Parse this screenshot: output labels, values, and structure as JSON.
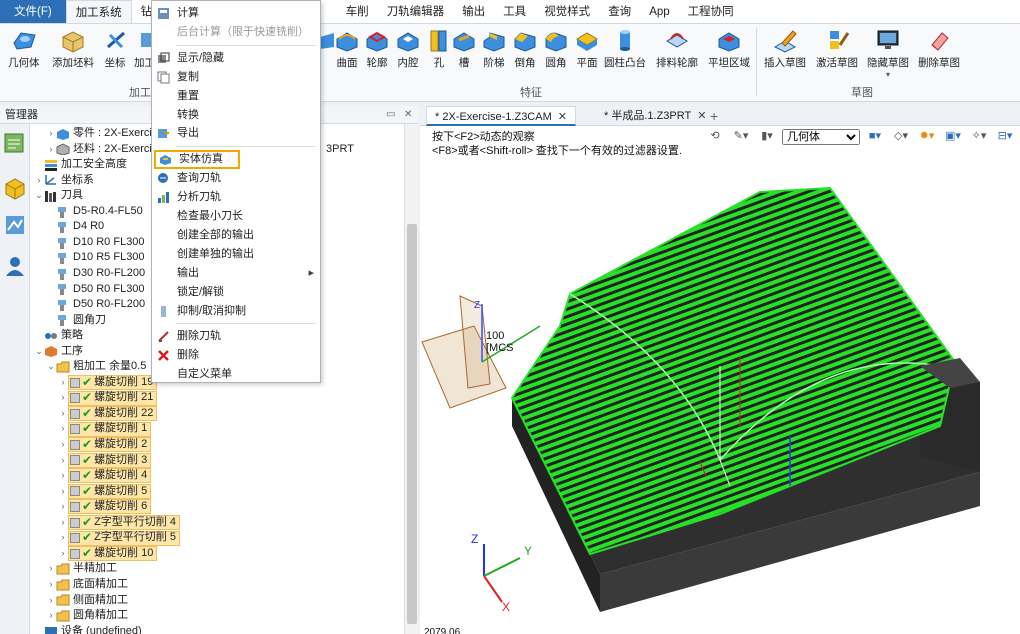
{
  "menubar": {
    "items": [
      "文件(F)",
      "加工系统",
      "钻孔",
      "刀",
      "车削",
      "刀轨编辑器",
      "输出",
      "工具",
      "视觉样式",
      "查询",
      "App",
      "工程协同"
    ]
  },
  "ribbon": {
    "buttons": [
      "几何体",
      "添加坯料",
      "坐标",
      "加工",
      "曲面",
      "轮廓",
      "内腔",
      "孔",
      "槽",
      "阶梯",
      "倒角",
      "圆角",
      "平面",
      "圆柱凸台",
      "排料轮廓",
      "平坦区域",
      "插入草图",
      "激活草图",
      "隐藏草图",
      "删除草图"
    ],
    "groups": [
      "加工",
      "特征",
      "草图"
    ]
  },
  "manager": {
    "title": "管理器"
  },
  "tree": [
    {
      "label": "零件 : 2X-Exercise-",
      "level": 1,
      "exp": ">",
      "icon": "part-icon"
    },
    {
      "label": "坯料 : 2X-Exercise",
      "level": 1,
      "exp": ">",
      "icon": "stock-icon",
      "suffix": "3PRT"
    },
    {
      "label": "加工安全高度",
      "level": 0,
      "exp": "",
      "icon": "safety-height-icon"
    },
    {
      "label": "坐标系",
      "level": 0,
      "exp": ">",
      "icon": "coordinate-icon"
    },
    {
      "label": "刀具",
      "level": 0,
      "exp": "v",
      "icon": "tools-icon"
    },
    {
      "label": "D5-R0.4-FL50",
      "level": 1,
      "exp": "",
      "icon": "tool-icon"
    },
    {
      "label": "D4 R0",
      "level": 1,
      "exp": "",
      "icon": "tool-icon"
    },
    {
      "label": "D10 R0 FL300",
      "level": 1,
      "exp": "",
      "icon": "tool-icon"
    },
    {
      "label": "D10 R5 FL300",
      "level": 1,
      "exp": "",
      "icon": "tool-icon"
    },
    {
      "label": "D30 R0-FL200",
      "level": 1,
      "exp": "",
      "icon": "tool-icon"
    },
    {
      "label": "D50 R0 FL300",
      "level": 1,
      "exp": "",
      "icon": "tool-icon"
    },
    {
      "label": "D50 R0-FL200",
      "level": 1,
      "exp": "",
      "icon": "tool-icon"
    },
    {
      "label": "圆角刀",
      "level": 1,
      "exp": "",
      "icon": "tool-icon"
    },
    {
      "label": "策略",
      "level": 0,
      "exp": "",
      "icon": "strategy-icon"
    },
    {
      "label": "工序",
      "level": 0,
      "exp": "v",
      "icon": "operations-icon"
    },
    {
      "label": "粗加工 余量0.5",
      "level": 1,
      "exp": "v",
      "icon": "folder-icon"
    },
    {
      "label": "螺旋切削 19",
      "level": 2,
      "exp": ">",
      "icon": "op",
      "hl": true
    },
    {
      "label": "螺旋切削 21",
      "level": 2,
      "exp": ">",
      "icon": "op",
      "hl": true
    },
    {
      "label": "螺旋切削 22",
      "level": 2,
      "exp": ">",
      "icon": "op",
      "hl": true
    },
    {
      "label": "螺旋切削 1",
      "level": 2,
      "exp": ">",
      "icon": "op",
      "hl": true
    },
    {
      "label": "螺旋切削 2",
      "level": 2,
      "exp": ">",
      "icon": "op",
      "hl": true
    },
    {
      "label": "螺旋切削 3",
      "level": 2,
      "exp": ">",
      "icon": "op",
      "hl": true
    },
    {
      "label": "螺旋切削 4",
      "level": 2,
      "exp": ">",
      "icon": "op",
      "hl": true
    },
    {
      "label": "螺旋切削 5",
      "level": 2,
      "exp": ">",
      "icon": "op",
      "hl": true
    },
    {
      "label": "螺旋切削 6",
      "level": 2,
      "exp": ">",
      "icon": "op",
      "hl": true
    },
    {
      "label": "Z字型平行切削 4",
      "level": 2,
      "exp": ">",
      "icon": "op",
      "hl": true
    },
    {
      "label": "Z字型平行切削 5",
      "level": 2,
      "exp": ">",
      "icon": "op",
      "hl": true
    },
    {
      "label": "螺旋切削 10",
      "level": 2,
      "exp": ">",
      "icon": "op",
      "hl": true
    },
    {
      "label": "半精加工",
      "level": 1,
      "exp": ">",
      "icon": "folder-icon"
    },
    {
      "label": "底面精加工",
      "level": 1,
      "exp": ">",
      "icon": "folder-icon"
    },
    {
      "label": "侧面精加工",
      "level": 1,
      "exp": ">",
      "icon": "folder-icon"
    },
    {
      "label": "圆角精加工",
      "level": 1,
      "exp": ">",
      "icon": "folder-icon"
    },
    {
      "label": "设备 (undefined)",
      "level": 0,
      "exp": "",
      "icon": "device-icon"
    }
  ],
  "tabs": [
    {
      "label": "* 2X-Exercise-1.Z3CAM",
      "close": "✕"
    },
    {
      "label": "* 半成品.1.Z3PRT",
      "close": "✕"
    },
    {
      "label": "+"
    }
  ],
  "viewport": {
    "hint_line1": "按下<F2>动态的观察",
    "hint_line2": "<F8>或者<Shift-roll> 查找下一个有效的过滤器设置.",
    "filter_value": "几何体",
    "csys_label": "100",
    "csys_sub": "[MCS",
    "axis_z": "Z",
    "axis_y": "Y",
    "axis_x": "X",
    "bottom_text": "2079.06"
  },
  "context_menu": {
    "items": [
      {
        "label": "计算",
        "icon": "calc-icon"
      },
      {
        "label": "后台计算（限于快速铣削）",
        "disabled": true
      },
      {
        "sep": true
      },
      {
        "label": "显示/隐藏",
        "icon": "show-hide-icon"
      },
      {
        "label": "复制",
        "icon": "copy-icon"
      },
      {
        "label": "重置"
      },
      {
        "label": "转换"
      },
      {
        "label": "导出",
        "icon": "export-icon"
      },
      {
        "sep": true
      },
      {
        "label": "实体仿真",
        "icon": "simulate-icon",
        "hl": true
      },
      {
        "label": "查询刀轨",
        "icon": "query-icon"
      },
      {
        "label": "分析刀轨",
        "icon": "analyze-icon"
      },
      {
        "label": "检查最小刀长"
      },
      {
        "label": "创建全部的输出"
      },
      {
        "label": "创建单独的输出"
      },
      {
        "label": "输出",
        "submenu": true
      },
      {
        "label": "锁定/解锁"
      },
      {
        "label": "抑制/取消抑制",
        "icon": "suppress-icon"
      },
      {
        "sep": true
      },
      {
        "label": "删除刀轨",
        "icon": "delete-path-icon"
      },
      {
        "label": "删除",
        "icon": "delete-icon"
      },
      {
        "label": "自定义菜单"
      }
    ]
  },
  "colors": {
    "accent": "#2c6fb7",
    "toolpath": "#22dd22",
    "highlight": "#fde6a8",
    "highlight_border": "#f2a900",
    "part": "#3a3a3a"
  }
}
